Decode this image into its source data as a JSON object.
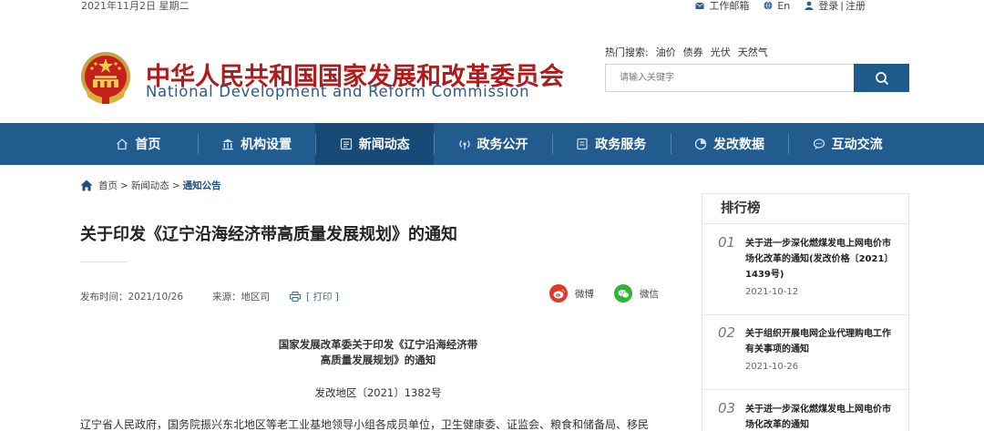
{
  "topbar": {
    "date": "2021年11月2日 星期二",
    "mail": "工作邮箱",
    "lang": "En",
    "login": "登录",
    "divider": "|",
    "register": "注册"
  },
  "header": {
    "title_cn": "中华人民共和国国家发展和改革委员会",
    "title_en": "National Development and Reform Commission",
    "hot_label": "热门搜索:",
    "hot_terms": [
      "油价",
      "债券",
      "光伏",
      "天然气"
    ],
    "search_placeholder": "请输入关键字"
  },
  "nav": {
    "items": [
      {
        "label": "首页",
        "icon": "home-icon"
      },
      {
        "label": "机构设置",
        "icon": "building-icon"
      },
      {
        "label": "新闻动态",
        "icon": "news-icon"
      },
      {
        "label": "政务公开",
        "icon": "broadcast-icon"
      },
      {
        "label": "政务服务",
        "icon": "service-icon"
      },
      {
        "label": "发改数据",
        "icon": "pie-chart-icon"
      },
      {
        "label": "互动交流",
        "icon": "chat-icon"
      }
    ],
    "active_index": 2
  },
  "breadcrumb": {
    "home": "首页",
    "level1": "新闻动态",
    "current": "通知公告",
    "sep": ">"
  },
  "article": {
    "title": "关于印发《辽宁沿海经济带高质量发展规划》的通知",
    "publish_time": "发布时间：2021/10/26",
    "source": "来源：地区司",
    "print": "[ 打印 ]",
    "share_weibo": "微博",
    "share_wechat": "微信",
    "doc_title_line1": "国家发展改革委关于印发《辽宁沿海经济带",
    "doc_title_line2": "高质量发展规划》的通知",
    "doc_number": "发改地区〔2021〕1382号",
    "body_first_line": "辽宁省人民政府，国务院振兴东北地区等老工业基地领导小组各成员单位，卫生健康委、证监会、粮食和储备局、移民"
  },
  "sidebar": {
    "title": "排行榜",
    "items": [
      {
        "num": "01",
        "title": "关于进一步深化燃煤发电上网电价市场化改革的通知(发改价格〔2021〕1439号)",
        "date": "2021-10-12"
      },
      {
        "num": "02",
        "title": "关于组织开展电网企业代理购电工作有关事项的通知",
        "date": "2021-10-26"
      },
      {
        "num": "03",
        "title": "关于进一步深化燃煤发电上网电价市场化改革的通知",
        "date": ""
      }
    ]
  },
  "colors": {
    "nav_bg": "#225c8e",
    "nav_active": "#174a77",
    "title_red": "#b01b1b",
    "en_blue": "#2d5a8a"
  }
}
